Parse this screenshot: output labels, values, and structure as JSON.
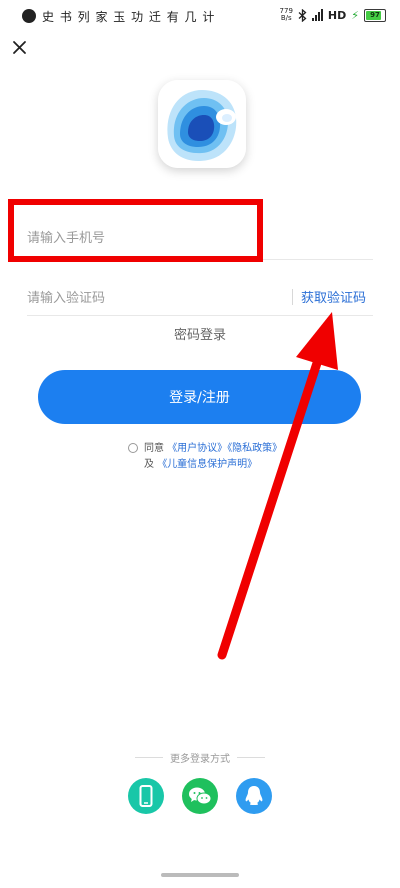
{
  "status_bar": {
    "left_text": "史 书 列 家 玉  功 迁 有 几 计",
    "speed_value": "779",
    "speed_unit": "B/s",
    "network": "HD",
    "battery": "97"
  },
  "login": {
    "phone_placeholder": "请输入手机号",
    "code_placeholder": "请输入验证码",
    "get_code": "获取验证码",
    "password_login": "密码登录",
    "submit": "登录/注册"
  },
  "agreement": {
    "agree": "同意",
    "user_agreement": "《用户协议》",
    "privacy_policy": "《隐私政策》",
    "and": "及",
    "child_privacy": "《儿童信息保护声明》"
  },
  "more_login": {
    "label": "更多登录方式",
    "methods": [
      {
        "icon": "phone-icon",
        "color": "#19c7a8"
      },
      {
        "icon": "wechat-icon",
        "color": "#1fc05d"
      },
      {
        "icon": "qq-icon",
        "color": "#2f9cf0"
      }
    ]
  },
  "annotation": {
    "box_color": "#f00000",
    "arrow_color": "#f00000"
  }
}
